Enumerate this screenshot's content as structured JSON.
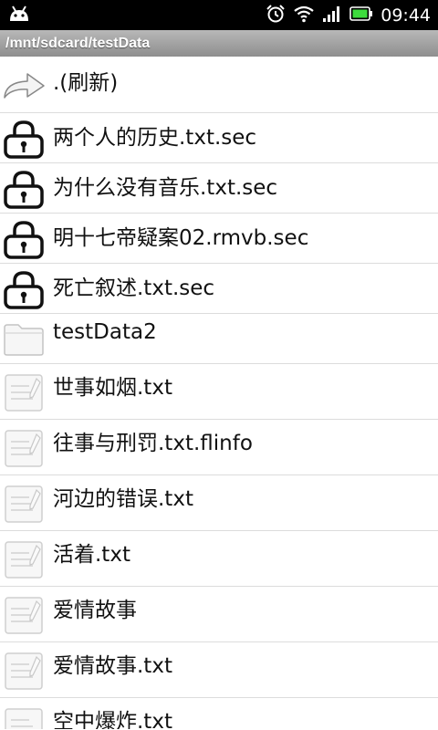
{
  "status_bar": {
    "time": "09:44"
  },
  "path_bar": {
    "path": "/mnt/sdcard/testData"
  },
  "files": [
    {
      "name": ".(刷新)",
      "icon": "refresh-arrow-icon"
    },
    {
      "name": "两个人的历史.txt.sec",
      "icon": "lock-icon"
    },
    {
      "name": "为什么没有音乐.txt.sec",
      "icon": "lock-icon"
    },
    {
      "name": "明十七帝疑案02.rmvb.sec",
      "icon": "lock-icon"
    },
    {
      "name": "死亡叙述.txt.sec",
      "icon": "lock-icon"
    },
    {
      "name": "testData2",
      "icon": "folder-icon"
    },
    {
      "name": "世事如烟.txt",
      "icon": "document-icon"
    },
    {
      "name": "往事与刑罚.txt.flinfo",
      "icon": "document-icon"
    },
    {
      "name": "河边的错误.txt",
      "icon": "document-icon"
    },
    {
      "name": "活着.txt",
      "icon": "document-icon"
    },
    {
      "name": "爱情故事",
      "icon": "document-icon"
    },
    {
      "name": "爱情故事.txt",
      "icon": "document-icon"
    },
    {
      "name": "空中爆炸.txt",
      "icon": "document-icon"
    }
  ]
}
